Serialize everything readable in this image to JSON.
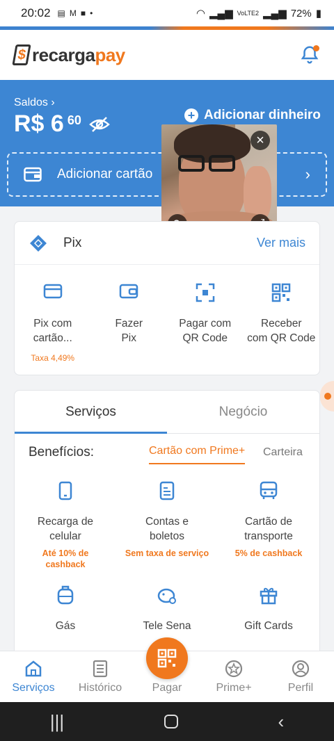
{
  "status_bar": {
    "time": "20:02",
    "battery": "72%",
    "network": "VoLTE2"
  },
  "header": {
    "logo_recarga": "recarga",
    "logo_pay": "pay"
  },
  "balance": {
    "label": "Saldos",
    "currency_value": "R$ 6",
    "cents": "60",
    "add_money": "Adicionar dinheiro",
    "add_card": "Adicionar cartão"
  },
  "pix": {
    "title": "Pix",
    "see_more": "Ver mais",
    "items": [
      {
        "line1": "Pix com",
        "line2": "cartão...",
        "note": "Taxa 4,49%"
      },
      {
        "line1": "Fazer",
        "line2": "Pix",
        "note": ""
      },
      {
        "line1": "Pagar com",
        "line2": "QR Code",
        "note": ""
      },
      {
        "line1": "Receber",
        "line2": "com QR Code",
        "note": ""
      }
    ]
  },
  "services": {
    "tabs": [
      "Serviços",
      "Negócio"
    ],
    "benefits_label": "Benefícios:",
    "subtabs": [
      "Cartão com Prime+",
      "Carteira"
    ],
    "items": [
      {
        "line1": "Recarga de",
        "line2": "celular",
        "note1": "Até 10% de",
        "note2": "cashback"
      },
      {
        "line1": "Contas e",
        "line2": "boletos",
        "note1": "Sem taxa de serviço",
        "note2": ""
      },
      {
        "line1": "Cartão de",
        "line2": "transporte",
        "note1": "5% de cashback",
        "note2": ""
      },
      {
        "line1": "Gás",
        "line2": "",
        "note1": "",
        "note2": ""
      },
      {
        "line1": "Tele Sena",
        "line2": "",
        "note1": "",
        "note2": ""
      },
      {
        "line1": "Gift Cards",
        "line2": "",
        "note1": "",
        "note2": ""
      }
    ]
  },
  "bottom_nav": {
    "items": [
      "Serviços",
      "Histórico",
      "Pagar",
      "Prime+",
      "Perfil"
    ]
  },
  "colors": {
    "brand_blue": "#3d86d3",
    "brand_orange": "#f0781e"
  }
}
